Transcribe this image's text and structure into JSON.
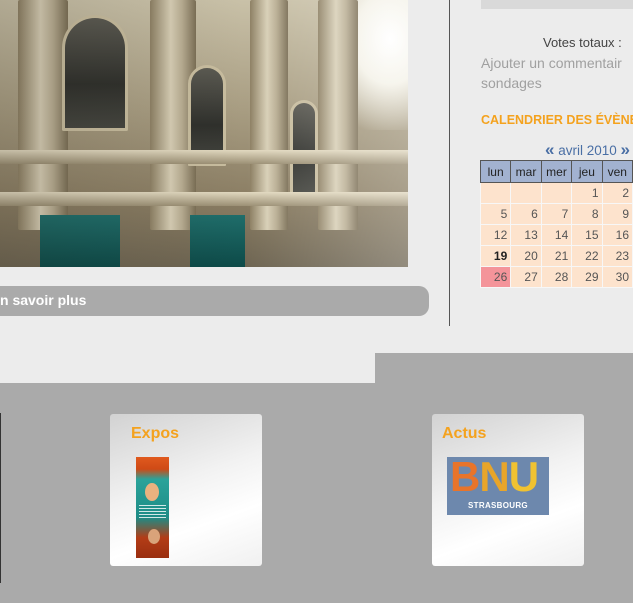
{
  "hero": {
    "link_label": "n savoir plus"
  },
  "poll": {
    "votes_label": "Votes totaux :",
    "comment_link_line1": "Ajouter un commentair",
    "comment_link_line2": "sondages"
  },
  "calendar": {
    "title": "CALENDRIER DES ÉVÈNE",
    "prev_arrow": "«",
    "month_label": "avril 2010",
    "next_arrow": "»",
    "weekdays": [
      "lun",
      "mar",
      "mer",
      "jeu",
      "ven"
    ],
    "weeks": [
      [
        "",
        "",
        "",
        "1",
        "2"
      ],
      [
        "5",
        "6",
        "7",
        "8",
        "9"
      ],
      [
        "12",
        "13",
        "14",
        "15",
        "16"
      ],
      [
        "19",
        "20",
        "21",
        "22",
        "23"
      ],
      [
        "26",
        "27",
        "28",
        "29",
        "30"
      ]
    ],
    "today": "19",
    "selected": "26",
    "colors": {
      "header": "#a2b2d0",
      "cell": "#fde3cd",
      "selected": "#f4949a",
      "accent": "#f4a21e"
    }
  },
  "cards": [
    {
      "title": "Expos",
      "image": "exposition-poster-thumbnail"
    },
    {
      "title": "Actus",
      "image": "bnu-logo",
      "logo_letters": [
        "B",
        "N",
        "U"
      ],
      "logo_city": "STRASBOURG"
    }
  ]
}
